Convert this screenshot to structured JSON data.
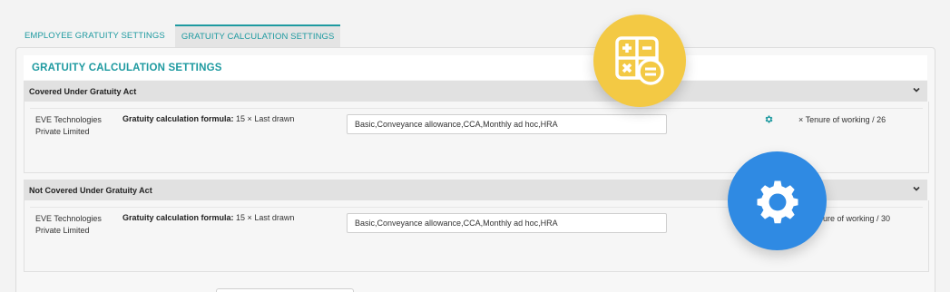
{
  "tabs": [
    {
      "label": "EMPLOYEE GRATUITY SETTINGS"
    },
    {
      "label": "GRATUITY CALCULATION SETTINGS"
    }
  ],
  "page_title": "GRATUITY CALCULATION SETTINGS",
  "sections": [
    {
      "header": "Covered Under Gratuity Act",
      "company_line1": "EVE Technologies",
      "company_line2": "Private Limited",
      "formula_label": "Gratuity calculation formula:",
      "formula_value": "15 × Last drawn",
      "components": "Basic,Conveyance allowance,CCA,Monthly ad hoc,HRA",
      "tenure": "× Tenure of working / 26"
    },
    {
      "header": "Not Covered Under Gratuity Act",
      "company_line1": "EVE Technologies",
      "company_line2": "Private Limited",
      "formula_label": "Gratuity calculation formula:",
      "formula_value": "15 × Last drawn",
      "components": "Basic,Conveyance allowance,CCA,Monthly ad hoc,HRA",
      "tenure": "ure of working / 30"
    }
  ],
  "icons": {
    "calculator": "calculator-icon",
    "gear_large": "gear-icon",
    "gear_small": "gear-icon",
    "chevron": "chevron-down-icon"
  },
  "colors": {
    "accent": "#1e9aa0",
    "calc_badge": "#f3c944",
    "gear_badge": "#2f8ae3"
  }
}
